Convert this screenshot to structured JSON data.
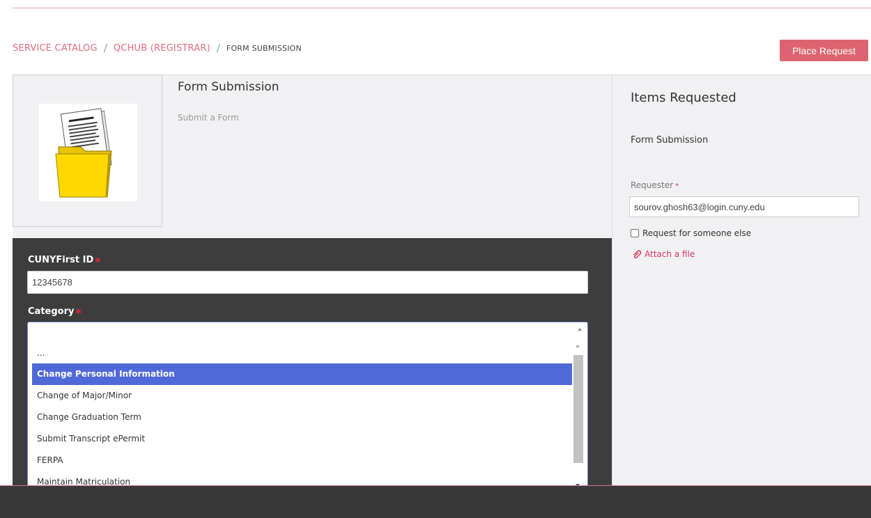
{
  "breadcrumb": {
    "items": [
      "SERVICE CATALOG",
      "QCHUB (REGISTRAR)"
    ],
    "current": "FORM SUBMISSION",
    "separator": "/"
  },
  "toolbar": {
    "place_request_label": "Place Request"
  },
  "catalog_item": {
    "title": "Form Submission",
    "short_description": "Submit a Form"
  },
  "form": {
    "cunyfirst_id": {
      "label": "CUNYFirst ID",
      "value": "12345678"
    },
    "category": {
      "label": "Category",
      "value": "",
      "options": [
        "...",
        "Change Personal Information",
        "Change of Major/Minor",
        "Change Graduation Term",
        "Submit Transcript ePermit",
        "FERPA",
        "Maintain Matriculation"
      ],
      "highlighted_index": 1
    },
    "required_marker": "*"
  },
  "items_requested": {
    "heading": "Items Requested",
    "item": "Form Submission",
    "requester_label": "Requester",
    "requester_value": "sourov.ghosh63@login.cuny.edu",
    "request_for_someone_else": "Request for someone else",
    "attach_file": "Attach a file"
  },
  "colors": {
    "accent": "#dc6470",
    "link": "#e06c82",
    "highlight": "#5069d8",
    "form_bg": "#3d3d3d"
  }
}
